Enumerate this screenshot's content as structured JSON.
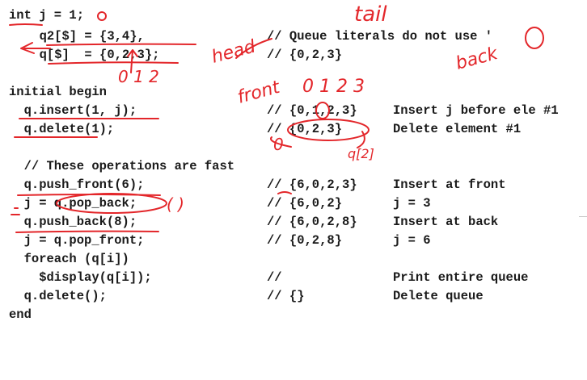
{
  "code_lines": [
    {
      "code": "int j = 1;",
      "comment": "",
      "note": ""
    },
    {
      "code": "  q2[$] = {3,4},",
      "comment": "// Queue literals do not use '",
      "note": ""
    },
    {
      "code": "  q[$]  = {0,2,3};",
      "comment": "// {0,2,3}",
      "note": ""
    },
    {
      "code": "",
      "comment": "",
      "note": ""
    },
    {
      "code": "initial begin",
      "comment": "",
      "note": ""
    },
    {
      "code": "  q.insert(1, j);",
      "comment": "// {0,1,2,3}",
      "note": "Insert j before ele #1"
    },
    {
      "code": "  q.delete(1);",
      "comment": "// {0,2,3}",
      "note": "Delete element #1"
    },
    {
      "code": "",
      "comment": "",
      "note": ""
    },
    {
      "code": "  // These operations are fast",
      "comment": "",
      "note": ""
    },
    {
      "code": "  q.push_front(6);",
      "comment": "// {6,0,2,3}",
      "note": "Insert at front"
    },
    {
      "code": "  j = q.pop_back;",
      "comment": "// {6,0,2}",
      "note": "j = 3"
    },
    {
      "code": "  q.push_back(8);",
      "comment": "// {6,0,2,8}",
      "note": "Insert at back"
    },
    {
      "code": "  j = q.pop_front;",
      "comment": "// {0,2,8}",
      "note": "j = 6"
    },
    {
      "code": "  foreach (q[i])",
      "comment": "",
      "note": ""
    },
    {
      "code": "    $display(q[i]);",
      "comment": "//",
      "note": "Print entire queue"
    },
    {
      "code": "  q.delete();",
      "comment": "// {}",
      "note": "Delete queue"
    },
    {
      "code": "end",
      "comment": "",
      "note": ""
    }
  ],
  "handwritten_notes": {
    "tail": "tail",
    "head": "head",
    "back": "back",
    "front": "front",
    "index_row": "0 1 2 3",
    "index_under_q": "0 1 2",
    "q2_label": "q[2]",
    "zero_mark": "0",
    "parens": "( )"
  },
  "ink_color": "#e3262a"
}
